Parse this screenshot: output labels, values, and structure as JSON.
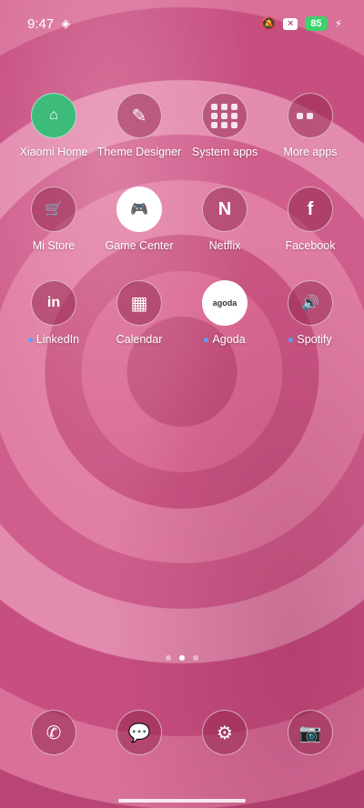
{
  "status": {
    "time": "9:47",
    "battery": "85"
  },
  "apps": [
    {
      "name": "xiaomi-home",
      "label": "Xiaomi Home",
      "glyph": "⌂",
      "dot": false
    },
    {
      "name": "theme-designer",
      "label": "Theme Designer",
      "glyph": "✎",
      "dot": false
    },
    {
      "name": "system-apps",
      "label": "System apps",
      "glyph": "",
      "dot": false
    },
    {
      "name": "more-apps",
      "label": "More apps",
      "glyph": "",
      "dot": false
    },
    {
      "name": "mi-store",
      "label": "Mi Store",
      "glyph": "🛒",
      "dot": false
    },
    {
      "name": "game-center",
      "label": "Game Center",
      "glyph": "🎮",
      "dot": false
    },
    {
      "name": "netflix",
      "label": "Netflix",
      "glyph": "N",
      "dot": false
    },
    {
      "name": "facebook",
      "label": "Facebook",
      "glyph": "f",
      "dot": false
    },
    {
      "name": "linkedin",
      "label": "LinkedIn",
      "glyph": "in",
      "dot": true
    },
    {
      "name": "calendar",
      "label": "Calendar",
      "glyph": "▦",
      "dot": false
    },
    {
      "name": "agoda",
      "label": "Agoda",
      "glyph": "agoda",
      "dot": true
    },
    {
      "name": "spotify",
      "label": "Spotify",
      "glyph": "🔊",
      "dot": true
    }
  ],
  "dock": [
    {
      "name": "phone",
      "glyph": "✆"
    },
    {
      "name": "messages",
      "glyph": "💬"
    },
    {
      "name": "settings",
      "glyph": "⚙"
    },
    {
      "name": "camera",
      "glyph": "📷"
    }
  ],
  "pager": {
    "pages": 3,
    "active": 1
  }
}
